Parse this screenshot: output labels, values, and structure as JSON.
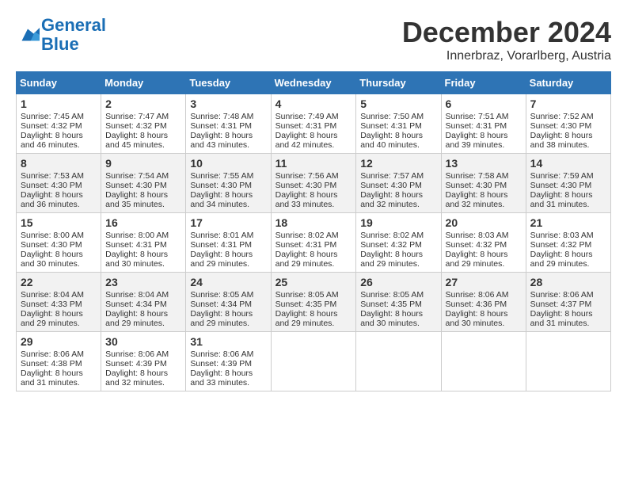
{
  "header": {
    "logo_line1": "General",
    "logo_line2": "Blue",
    "month": "December 2024",
    "location": "Innerbraz, Vorarlberg, Austria"
  },
  "weekdays": [
    "Sunday",
    "Monday",
    "Tuesday",
    "Wednesday",
    "Thursday",
    "Friday",
    "Saturday"
  ],
  "weeks": [
    [
      {
        "day": "1",
        "lines": [
          "Sunrise: 7:45 AM",
          "Sunset: 4:32 PM",
          "Daylight: 8 hours",
          "and 46 minutes."
        ]
      },
      {
        "day": "2",
        "lines": [
          "Sunrise: 7:47 AM",
          "Sunset: 4:32 PM",
          "Daylight: 8 hours",
          "and 45 minutes."
        ]
      },
      {
        "day": "3",
        "lines": [
          "Sunrise: 7:48 AM",
          "Sunset: 4:31 PM",
          "Daylight: 8 hours",
          "and 43 minutes."
        ]
      },
      {
        "day": "4",
        "lines": [
          "Sunrise: 7:49 AM",
          "Sunset: 4:31 PM",
          "Daylight: 8 hours",
          "and 42 minutes."
        ]
      },
      {
        "day": "5",
        "lines": [
          "Sunrise: 7:50 AM",
          "Sunset: 4:31 PM",
          "Daylight: 8 hours",
          "and 40 minutes."
        ]
      },
      {
        "day": "6",
        "lines": [
          "Sunrise: 7:51 AM",
          "Sunset: 4:31 PM",
          "Daylight: 8 hours",
          "and 39 minutes."
        ]
      },
      {
        "day": "7",
        "lines": [
          "Sunrise: 7:52 AM",
          "Sunset: 4:30 PM",
          "Daylight: 8 hours",
          "and 38 minutes."
        ]
      }
    ],
    [
      {
        "day": "8",
        "lines": [
          "Sunrise: 7:53 AM",
          "Sunset: 4:30 PM",
          "Daylight: 8 hours",
          "and 36 minutes."
        ]
      },
      {
        "day": "9",
        "lines": [
          "Sunrise: 7:54 AM",
          "Sunset: 4:30 PM",
          "Daylight: 8 hours",
          "and 35 minutes."
        ]
      },
      {
        "day": "10",
        "lines": [
          "Sunrise: 7:55 AM",
          "Sunset: 4:30 PM",
          "Daylight: 8 hours",
          "and 34 minutes."
        ]
      },
      {
        "day": "11",
        "lines": [
          "Sunrise: 7:56 AM",
          "Sunset: 4:30 PM",
          "Daylight: 8 hours",
          "and 33 minutes."
        ]
      },
      {
        "day": "12",
        "lines": [
          "Sunrise: 7:57 AM",
          "Sunset: 4:30 PM",
          "Daylight: 8 hours",
          "and 32 minutes."
        ]
      },
      {
        "day": "13",
        "lines": [
          "Sunrise: 7:58 AM",
          "Sunset: 4:30 PM",
          "Daylight: 8 hours",
          "and 32 minutes."
        ]
      },
      {
        "day": "14",
        "lines": [
          "Sunrise: 7:59 AM",
          "Sunset: 4:30 PM",
          "Daylight: 8 hours",
          "and 31 minutes."
        ]
      }
    ],
    [
      {
        "day": "15",
        "lines": [
          "Sunrise: 8:00 AM",
          "Sunset: 4:30 PM",
          "Daylight: 8 hours",
          "and 30 minutes."
        ]
      },
      {
        "day": "16",
        "lines": [
          "Sunrise: 8:00 AM",
          "Sunset: 4:31 PM",
          "Daylight: 8 hours",
          "and 30 minutes."
        ]
      },
      {
        "day": "17",
        "lines": [
          "Sunrise: 8:01 AM",
          "Sunset: 4:31 PM",
          "Daylight: 8 hours",
          "and 29 minutes."
        ]
      },
      {
        "day": "18",
        "lines": [
          "Sunrise: 8:02 AM",
          "Sunset: 4:31 PM",
          "Daylight: 8 hours",
          "and 29 minutes."
        ]
      },
      {
        "day": "19",
        "lines": [
          "Sunrise: 8:02 AM",
          "Sunset: 4:32 PM",
          "Daylight: 8 hours",
          "and 29 minutes."
        ]
      },
      {
        "day": "20",
        "lines": [
          "Sunrise: 8:03 AM",
          "Sunset: 4:32 PM",
          "Daylight: 8 hours",
          "and 29 minutes."
        ]
      },
      {
        "day": "21",
        "lines": [
          "Sunrise: 8:03 AM",
          "Sunset: 4:32 PM",
          "Daylight: 8 hours",
          "and 29 minutes."
        ]
      }
    ],
    [
      {
        "day": "22",
        "lines": [
          "Sunrise: 8:04 AM",
          "Sunset: 4:33 PM",
          "Daylight: 8 hours",
          "and 29 minutes."
        ]
      },
      {
        "day": "23",
        "lines": [
          "Sunrise: 8:04 AM",
          "Sunset: 4:34 PM",
          "Daylight: 8 hours",
          "and 29 minutes."
        ]
      },
      {
        "day": "24",
        "lines": [
          "Sunrise: 8:05 AM",
          "Sunset: 4:34 PM",
          "Daylight: 8 hours",
          "and 29 minutes."
        ]
      },
      {
        "day": "25",
        "lines": [
          "Sunrise: 8:05 AM",
          "Sunset: 4:35 PM",
          "Daylight: 8 hours",
          "and 29 minutes."
        ]
      },
      {
        "day": "26",
        "lines": [
          "Sunrise: 8:05 AM",
          "Sunset: 4:35 PM",
          "Daylight: 8 hours",
          "and 30 minutes."
        ]
      },
      {
        "day": "27",
        "lines": [
          "Sunrise: 8:06 AM",
          "Sunset: 4:36 PM",
          "Daylight: 8 hours",
          "and 30 minutes."
        ]
      },
      {
        "day": "28",
        "lines": [
          "Sunrise: 8:06 AM",
          "Sunset: 4:37 PM",
          "Daylight: 8 hours",
          "and 31 minutes."
        ]
      }
    ],
    [
      {
        "day": "29",
        "lines": [
          "Sunrise: 8:06 AM",
          "Sunset: 4:38 PM",
          "Daylight: 8 hours",
          "and 31 minutes."
        ]
      },
      {
        "day": "30",
        "lines": [
          "Sunrise: 8:06 AM",
          "Sunset: 4:39 PM",
          "Daylight: 8 hours",
          "and 32 minutes."
        ]
      },
      {
        "day": "31",
        "lines": [
          "Sunrise: 8:06 AM",
          "Sunset: 4:39 PM",
          "Daylight: 8 hours",
          "and 33 minutes."
        ]
      },
      null,
      null,
      null,
      null
    ]
  ]
}
